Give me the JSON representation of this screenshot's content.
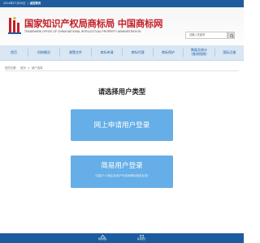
{
  "topbar": {
    "date": "2024年07月04日",
    "separator": "|",
    "link": "返回首页"
  },
  "header": {
    "title": "国家知识产权局商标局 中国商标网",
    "subtitle": "TRADEMARK OFFICE OF CHINA NATIONAL INTELLECTUAL PROPERTY ADMINISTRATION",
    "search_placeholder": "请输入关键词"
  },
  "nav": {
    "items": [
      {
        "label": "首页"
      },
      {
        "label": "机构概况"
      },
      {
        "label": "政策文件"
      },
      {
        "label": "商标申请"
      },
      {
        "label": "商标代理"
      },
      {
        "label": "商标保护"
      },
      {
        "label": "数据及统计\n(查询指南)"
      },
      {
        "label": "国际注册"
      }
    ]
  },
  "breadcrumb": {
    "label": "您的位置：",
    "home": "首页",
    "sep": ">",
    "current": "用户选择"
  },
  "main": {
    "heading": "请选择用户类型",
    "online_button": "网上申请用户登录",
    "simple_button": "简易用户登录",
    "simple_note": "（包括个人和企业用户可查询商标相关业务）"
  },
  "footer": {
    "items": [
      {
        "label": "网站地图"
      },
      {
        "label": "联系我们"
      }
    ]
  },
  "colors": {
    "brand_blue": "#1e5c9e",
    "nav_bg": "#d9e6f3",
    "button_blue": "#65aee7",
    "title_red": "#c3202a"
  }
}
